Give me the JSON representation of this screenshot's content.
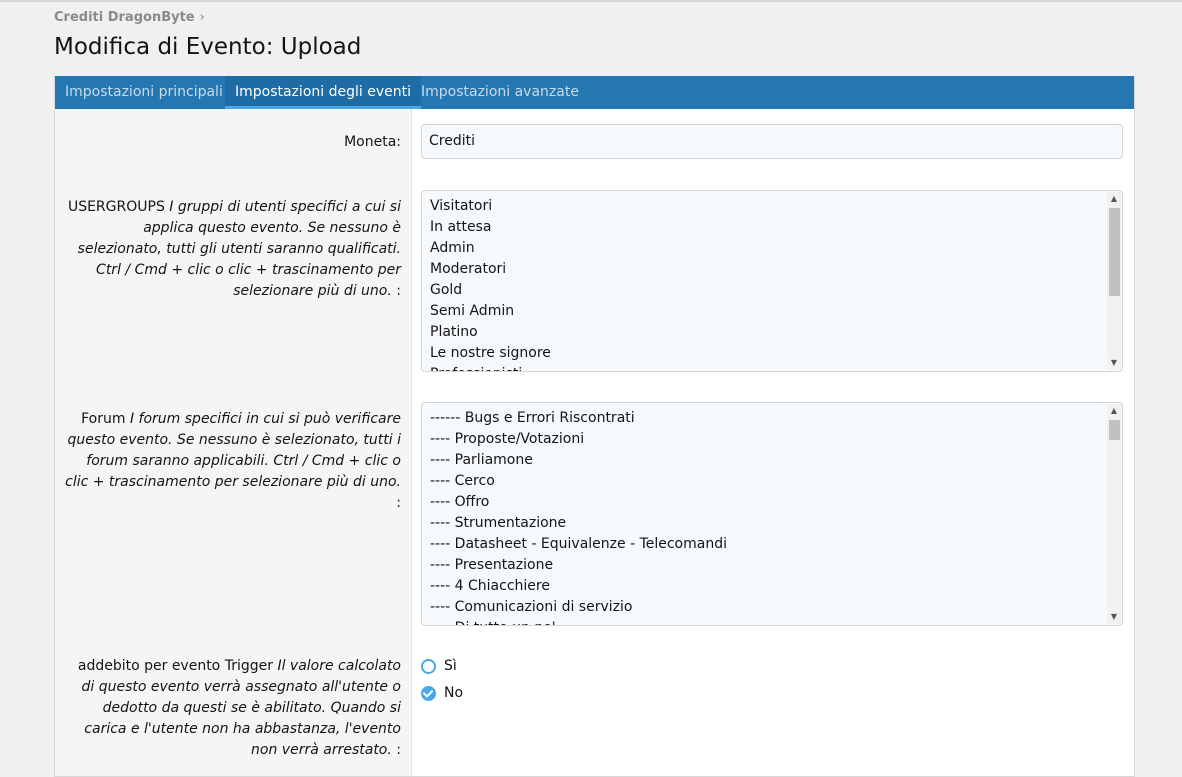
{
  "breadcrumb": {
    "item": "Crediti DragonByte",
    "separator": "›"
  },
  "page": {
    "title": "Modifica di Evento: Upload"
  },
  "tabs": [
    {
      "label": "Impostazioni principali",
      "active": false
    },
    {
      "label": "Impostazioni degli eventi",
      "active": true
    },
    {
      "label": "Impostazioni avanzate",
      "active": false
    }
  ],
  "form": {
    "currency": {
      "label": "Moneta:",
      "value": "Crediti"
    },
    "usergroups": {
      "label_title": "USERGROUPS",
      "label_desc": "I gruppi di utenti specifici a cui si applica questo evento. Se nessuno è selezionato, tutti gli utenti saranno qualificati. Ctrl / Cmd + clic o clic + trascinamento per selezionare più di uno.",
      "label_suffix": " :",
      "options": [
        "Visitatori",
        "In attesa",
        "Admin",
        "Moderatori",
        "Gold",
        "Semi Admin",
        "Platino",
        "Le nostre signore",
        "Professionisti"
      ]
    },
    "forums": {
      "label_title": "Forum",
      "label_desc": "I forum specifici in cui si può verificare questo evento. Se nessuno è selezionato, tutti i forum saranno applicabili. Ctrl / Cmd + clic o clic + trascinamento per selezionare più di uno.",
      "label_suffix": " :",
      "options": [
        "------ Bugs e Errori Riscontrati",
        "---- Proposte/Votazioni",
        "---- Parliamone",
        "---- Cerco",
        "---- Offro",
        "---- Strumentazione",
        "---- Datasheet - Equivalenze - Telecomandi",
        "---- Presentazione",
        "---- 4 Chiacchiere",
        "---- Comunicazioni di servizio",
        "---- Di tutto un po'"
      ]
    },
    "trigger": {
      "label_title": "addebito per evento Trigger",
      "label_desc": "Il valore calcolato di questo evento verrà assegnato all'utente o dedotto da questi se è abilitato. Quando si carica e l'utente non ha abbastanza, l'evento non verrà arrestato.",
      "label_suffix": " :",
      "options": [
        {
          "label": "Sì",
          "selected": false
        },
        {
          "label": "No",
          "selected": true
        }
      ]
    }
  },
  "icons": {
    "breadcrumb_chevron": "chevron-right-icon",
    "scroll_up": "arrow-up-icon",
    "scroll_down": "arrow-down-icon",
    "radio_checked": "checkmark-icon"
  },
  "colors": {
    "tab_bar": "#2577b1",
    "accent": "#47a7eb"
  }
}
